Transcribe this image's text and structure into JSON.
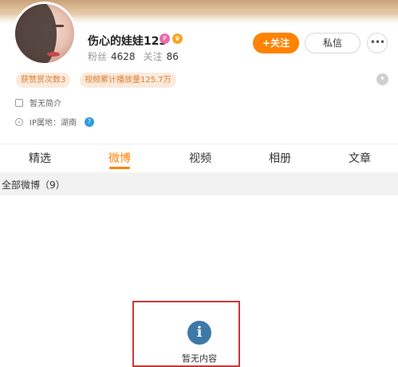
{
  "profile": {
    "name": "伤心的娃娃123",
    "fans_label": "粉丝",
    "fans_count": "4628",
    "following_label": "关注",
    "following_count": "86"
  },
  "actions": {
    "follow_label": "+关注",
    "message_label": "私信",
    "more_label": "•••"
  },
  "pills": [
    "获赞赏次数3",
    "视频累计播放量125.7万"
  ],
  "info": {
    "intro": "暂无简介",
    "ip_location": "IP属地：湖南"
  },
  "tabs": [
    {
      "label": "精选",
      "active": false
    },
    {
      "label": "微博",
      "active": true
    },
    {
      "label": "视频",
      "active": false
    },
    {
      "label": "相册",
      "active": false
    },
    {
      "label": "文章",
      "active": false
    }
  ],
  "section": {
    "title": "全部微博（9）"
  },
  "empty_state": {
    "icon_glyph": "i",
    "text": "暂无内容"
  },
  "colors": {
    "accent": "#ff8200",
    "pill_bg": "#fbeadc",
    "annotation_box": "#c8373a",
    "info_icon": "#3e78a8"
  },
  "icons": [
    "verified-badge-icon",
    "crown-icon",
    "expand-chevron-icon",
    "info-doc-icon",
    "location-icon",
    "help-icon",
    "empty-info-icon"
  ]
}
